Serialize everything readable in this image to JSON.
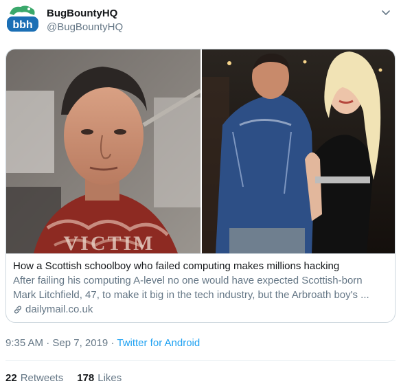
{
  "tweet": {
    "display_name": "BugBountyHQ",
    "handle": "@BugBountyHQ",
    "avatar_text": "bbh",
    "timestamp": "9:35 AM · Sep 7, 2019",
    "separator": " · ",
    "source": "Twitter for Android"
  },
  "card": {
    "title": "How a Scottish schoolboy who failed computing makes millions hacking",
    "description_line1": "After failing his computing A-level no one would have expected Scottish-born",
    "description_line2": "Mark Litchfield, 47, to make it big in the tech industry, but the Arbroath boy's ...",
    "domain": "dailymail.co.uk",
    "image_left_text": "VICTIM"
  },
  "stats": {
    "retweets_count": "22",
    "retweets_label": "Retweets",
    "likes_count": "178",
    "likes_label": "Likes"
  },
  "colors": {
    "link": "#1da1f2",
    "secondary": "#657786",
    "border": "#ccd6dd"
  }
}
